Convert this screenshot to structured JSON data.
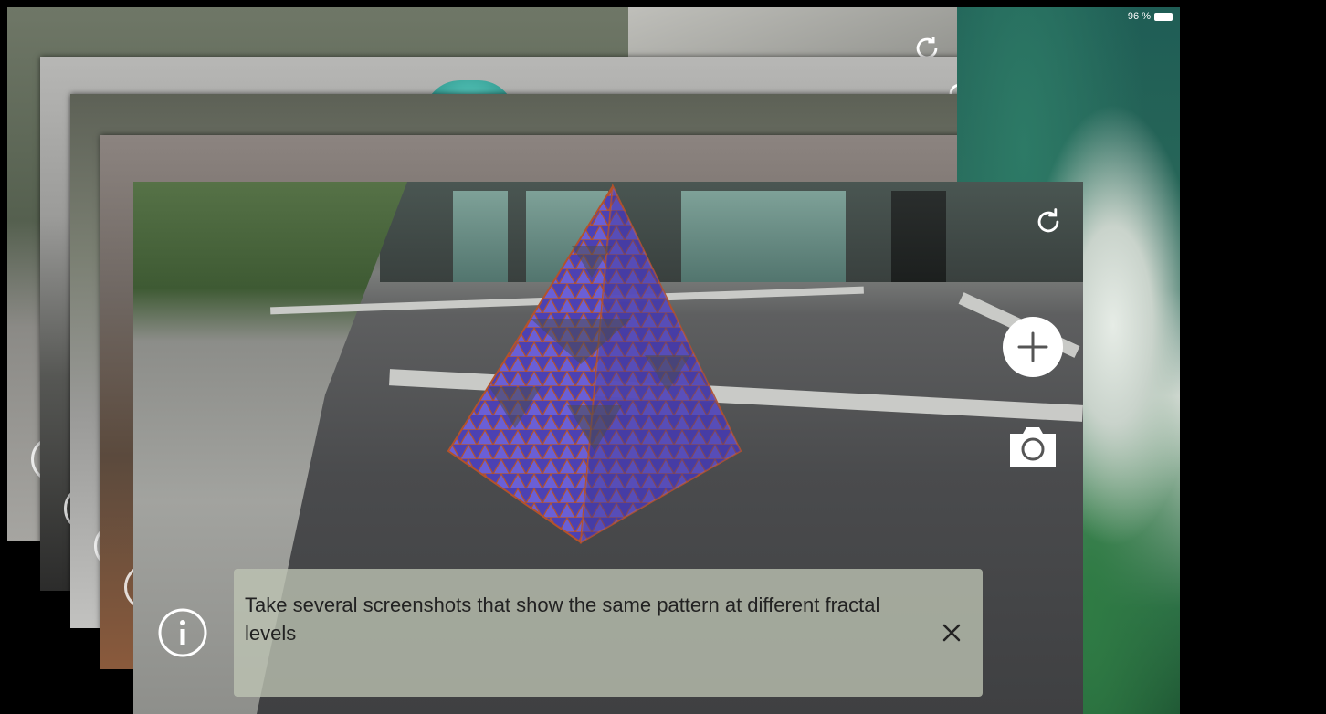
{
  "status_bar": {
    "battery_text": "96 %"
  },
  "toolbar": {
    "refresh_icon": "refresh-icon",
    "add_icon": "plus-icon",
    "camera_icon": "camera-icon"
  },
  "hint": {
    "info_icon": "info-icon",
    "text": "Take several screenshots that show the same pattern at different fractal levels",
    "close_icon": "close-icon"
  },
  "colors": {
    "pyramid_face": "#5a4fc4",
    "pyramid_edge": "#b4522a",
    "banner_bg": "#bec4b4"
  }
}
